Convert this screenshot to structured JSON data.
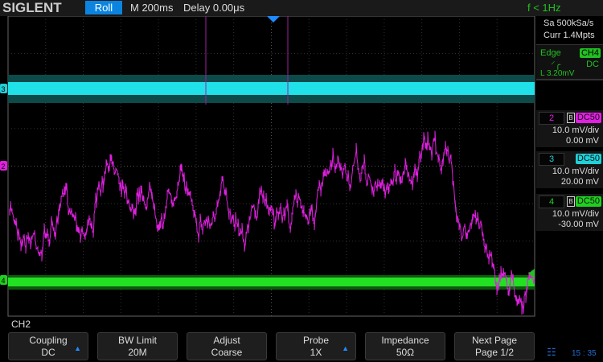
{
  "header": {
    "brand": "SIGLENT",
    "mode": "Roll",
    "timebase": "M 200ms",
    "delay": "Delay 0.00μs",
    "trigger_freq": "f < 1Hz"
  },
  "acquisition": {
    "sample_rate": "Sa 500kSa/s",
    "memory": "Curr 1.4Mpts"
  },
  "trigger": {
    "type": "Edge",
    "source": "CH4",
    "slope_icon": "rising-edge-icon",
    "coupling": "DC",
    "level": "L  3.20mV"
  },
  "channels": [
    {
      "num": "2",
      "coupling": "DC50",
      "scale": "10.0 mV/div",
      "offset": "0.00 mV",
      "color": "#e020e0",
      "bw": true
    },
    {
      "num": "3",
      "coupling": "DC50",
      "scale": "10.0 mV/div",
      "offset": "20.00 mV",
      "color": "#20d0d8",
      "bw": false
    },
    {
      "num": "4",
      "coupling": "DC50",
      "scale": "10.0 mV/div",
      "offset": "-30.00 mV",
      "color": "#20d020",
      "bw": true
    }
  ],
  "menu": {
    "title": "CH2",
    "buttons": [
      {
        "top": "Coupling",
        "bottom": "DC",
        "arrow": true
      },
      {
        "top": "BW Limit",
        "bottom": "20M",
        "arrow": false
      },
      {
        "top": "Adjust",
        "bottom": "Coarse",
        "arrow": false
      },
      {
        "top": "Probe",
        "bottom": "1X",
        "arrow": true
      },
      {
        "top": "Impedance",
        "bottom": "50Ω",
        "arrow": false
      },
      {
        "top": "Next Page",
        "bottom": "Page 1/2",
        "arrow": false
      }
    ]
  },
  "status": {
    "time": "15 : 35",
    "network_icon": "network-icon"
  },
  "markers": {
    "ch3": "3",
    "ch2": "2",
    "ch4": "4"
  }
}
